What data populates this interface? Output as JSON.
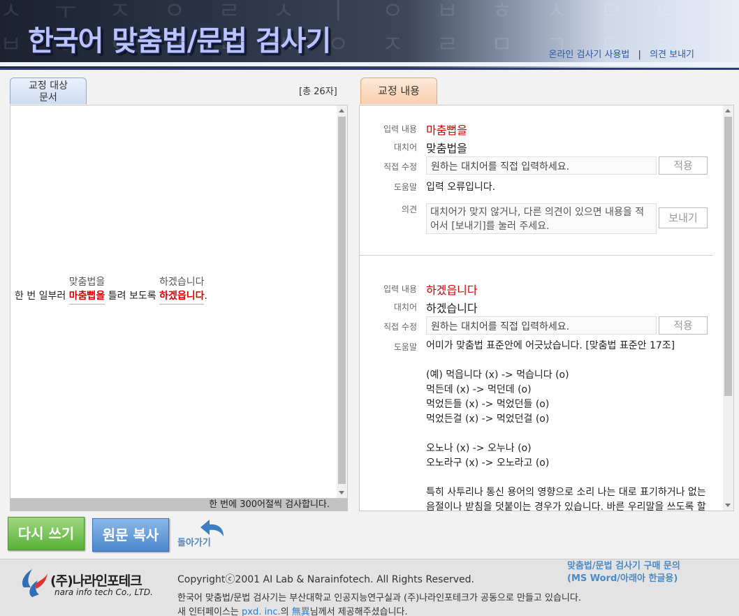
{
  "header": {
    "title": "한국어 맞춤법/문법 검사기",
    "links": [
      "온라인 검사기 사용법",
      "의견 보내기"
    ],
    "separator": "|"
  },
  "left": {
    "tab_label_line1": "교정 대상",
    "tab_label_line2": "문서",
    "char_count": "[총 26자]",
    "source": {
      "part1": "한 번 일부러 ",
      "error1": {
        "wrong": "마춤뻡을",
        "suggestion": "맞춤법을"
      },
      "part2": " 틀려 보도록 ",
      "error2": {
        "wrong": "하겠읍니다",
        "suggestion": "하겠습니다"
      },
      "part3": "."
    },
    "footer_note": "한 번에 300어절씩 검사합니다."
  },
  "right": {
    "tab_label": "교정 내용",
    "labels": {
      "input": "입력 내용",
      "replacement": "대치어",
      "direct_edit": "직접 수정",
      "help": "도움말",
      "opinion": "의견"
    },
    "apply_button": "적용",
    "send_button": "보내기",
    "direct_placeholder": "원하는 대치어를 직접 입력하세요.",
    "opinion_placeholder": "대치어가 맞지 않거나, 다른 의견이 있으면 내용을 적어서 [보내기]를 눌러 주세요.",
    "entries": [
      {
        "input": "마춤뻡을",
        "replacement": "맞춤법을",
        "help": [
          "입력 오류입니다."
        ]
      },
      {
        "input": "하겠읍니다",
        "replacement": "하겠습니다",
        "help": [
          "어미가 맞춤법 표준안에 어긋났습니다. [맞춤법 표준안 17조]",
          "",
          "(예) 먹읍니다 (x) -> 먹습니다 (o)",
          "먹든데 (x) -> 먹던데 (o)",
          "먹었든들 (x) -> 먹었던들 (o)",
          "먹었든걸 (x) -> 먹었던걸 (o)",
          "",
          "오노나 (x) -> 오누나 (o)",
          "오노라구 (x) -> 오노라고 (o)",
          "",
          "특히 사투리나 통신 용어의 영향으로 소리 나는 대로 표기하거나 없는",
          "음절이나 받침을 덧붙이는 경우가 있습니다. 바른 우리말을 쓰도록 할"
        ]
      }
    ]
  },
  "buttons": {
    "rewrite": "다시 쓰기",
    "copy": "원문 복사",
    "back": "돌아가기"
  },
  "footer": {
    "company": "(주)나라인포테크",
    "company_en": "nara info tech Co., LTD.",
    "copyright": "Copyrightⓒ2001 AI Lab & Narainfotech. All Rights Reserved.",
    "credit1": "한국어 맞춤법/문법 검사기는 부산대학교 인공지능연구실과 (주)나라인포테크가 공동으로 만들고 있습니다.",
    "credit2_prefix": "새 인터페이스는 ",
    "credit2_link1": "pxd. inc.",
    "credit2_mid": "의 ",
    "credit2_link2": "無異",
    "credit2_suffix": "님께서 제공해주셨습니다.",
    "purchase_line1": "맞춤법/문법 검사기 구매 문의",
    "purchase_line2": "(MS Word/아래아 한글용)"
  },
  "colors": {
    "error_red": "#d60000",
    "header_blue": "#2d3a78",
    "link_blue": "#2a5aa8",
    "rewrite_green": "#59b136",
    "copy_blue": "#4b86cc"
  }
}
